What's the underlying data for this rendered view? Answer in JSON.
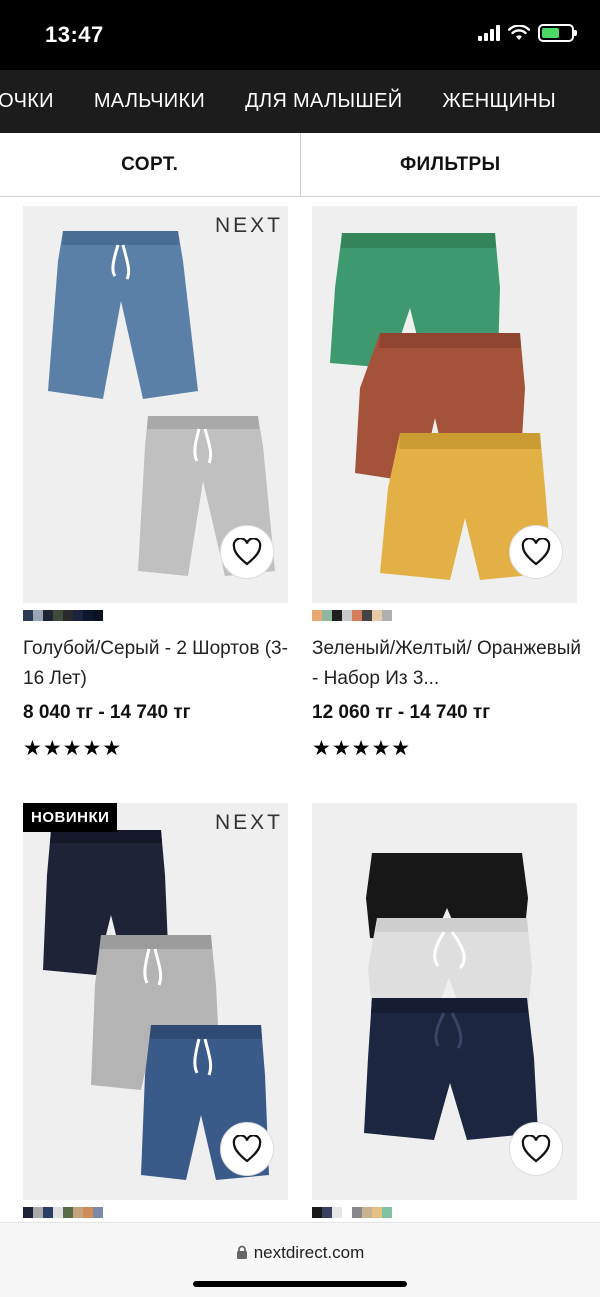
{
  "status": {
    "time": "13:47"
  },
  "categories": [
    "ЗОЧКИ",
    "МАЛЬЧИКИ",
    "ДЛЯ МАЛЫШЕЙ",
    "ЖЕНЩИНЫ"
  ],
  "toolbar": {
    "sort_label": "СОРТ.",
    "filter_label": "ФИЛЬТРЫ"
  },
  "products": [
    {
      "brand": "NEXT",
      "badge": "",
      "title": "Голубой/Серый - 2 Шортов (3-16 Лет)",
      "price": "8 040 тг - 14 740 тг",
      "rating": "★★★★★",
      "swatch_colors": [
        "#2b3a55",
        "#9aa6b8",
        "#1e2433",
        "#3f4a3a",
        "#2a2a2a",
        "#1b2340",
        "#0f1730",
        "#0d1222"
      ],
      "garment_colors": [
        "#5b80a8",
        "#c0c0c0"
      ]
    },
    {
      "brand": "",
      "badge": "",
      "title": "Зеленый/Желтый/ Оранжевый - Набор Из 3...",
      "price": "12 060 тг - 14 740 тг",
      "rating": "★★★★★",
      "swatch_colors": [
        "#e8a870",
        "#8fb7a0",
        "#1f1f1f",
        "#c9c9c9",
        "#d77d5c",
        "#444444",
        "#e8c9a8",
        "#b0b0b0"
      ],
      "garment_colors": [
        "#3e9a6e",
        "#a4533a",
        "#e2b044"
      ]
    },
    {
      "brand": "NEXT",
      "badge": "НОВИНКИ",
      "title": "",
      "price": "",
      "rating": "",
      "swatch_colors": [
        "#1d2238",
        "#aaaaaa",
        "#2b3f66",
        "#e0e0e0",
        "#5a6b4a",
        "#c4a27a",
        "#d08c56",
        "#7a8aa8"
      ],
      "garment_colors": [
        "#1e2338",
        "#b4b4b4",
        "#3a5a8a"
      ]
    },
    {
      "brand": "",
      "badge": "",
      "title": "",
      "price": "",
      "rating": "",
      "swatch_colors": [
        "#1a1a1a",
        "#3a4060",
        "#e6e6e6",
        "#ffffff",
        "#888888",
        "#c8b090",
        "#e4c080",
        "#7fc2a2"
      ],
      "garment_colors": [
        "#171717",
        "#dedede",
        "#1d2640"
      ]
    }
  ],
  "browser": {
    "url": "nextdirect.com"
  }
}
